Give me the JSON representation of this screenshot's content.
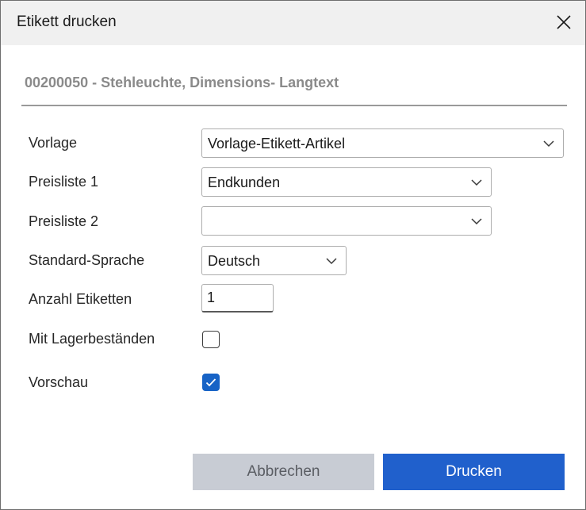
{
  "dialog": {
    "title": "Etikett drucken",
    "heading": "00200050 - Stehleuchte, Dimensions-  Langtext"
  },
  "form": {
    "vorlage": {
      "label": "Vorlage",
      "value": "Vorlage-Etikett-Artikel"
    },
    "preisliste1": {
      "label": "Preisliste 1",
      "value": "Endkunden"
    },
    "preisliste2": {
      "label": "Preisliste 2",
      "value": ""
    },
    "sprache": {
      "label": "Standard-Sprache",
      "value": "Deutsch"
    },
    "anzahl": {
      "label": "Anzahl Etiketten",
      "value": "1"
    },
    "lager": {
      "label": "Mit Lagerbeständen",
      "checked": false
    },
    "vorschau": {
      "label": "Vorschau",
      "checked": true
    }
  },
  "buttons": {
    "cancel": "Abbrechen",
    "print": "Drucken"
  },
  "icons": {
    "close": "close-icon",
    "dropdown": "chevron-down-icon",
    "check": "checkmark-icon"
  },
  "colors": {
    "accent": "#2060cc",
    "checkbox_checked": "#1763c6",
    "cancel_bg": "#c8ccd4"
  }
}
